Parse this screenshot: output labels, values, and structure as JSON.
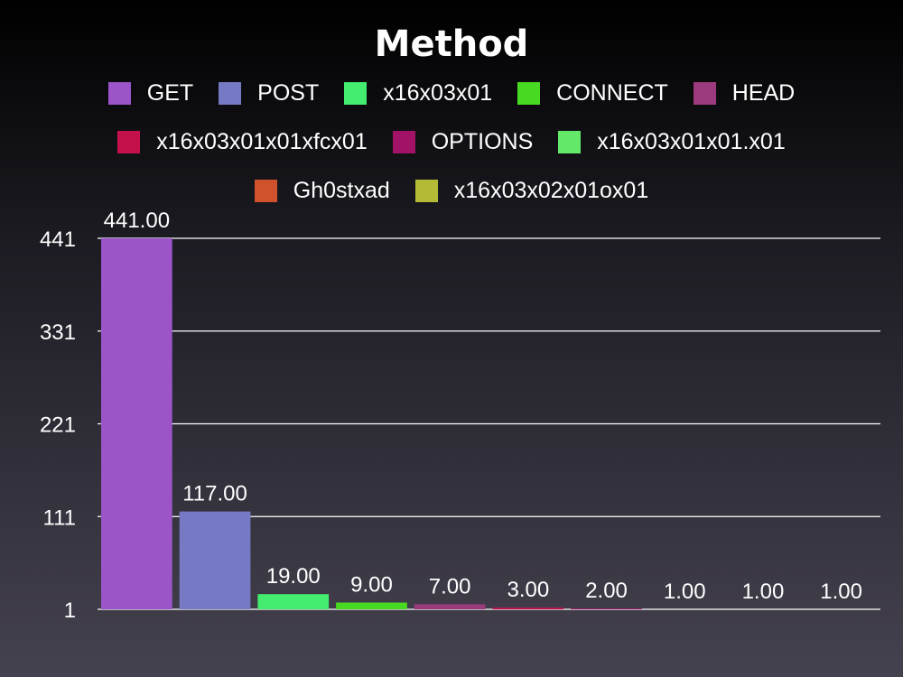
{
  "chart_data": {
    "type": "bar",
    "title": "Method",
    "categories": [
      "GET",
      "POST",
      "x16x03x01",
      "CONNECT",
      "HEAD",
      "x16x03x01x01xfcx01",
      "OPTIONS",
      "x16x03x01x01.x01",
      "Gh0stxad",
      "x16x03x02x01ox01"
    ],
    "values": [
      441,
      117,
      19,
      9,
      7,
      3,
      2,
      1,
      1,
      1
    ],
    "value_labels": [
      "441.00",
      "117.00",
      "19.00",
      "9.00",
      "7.00",
      "3.00",
      "2.00",
      "1.00",
      "1.00",
      "1.00"
    ],
    "colors": [
      "#9b55c9",
      "#7679c4",
      "#44ec6f",
      "#48d922",
      "#9b3a7c",
      "#c5114b",
      "#a21368",
      "#64e86a",
      "#d0522c",
      "#b5ba36"
    ],
    "yticks": [
      441,
      331,
      221,
      111,
      1
    ],
    "ylim": [
      1,
      441
    ],
    "legend_rows": [
      [
        0,
        1,
        2,
        3,
        4
      ],
      [
        5,
        6,
        7
      ],
      [
        8,
        9
      ]
    ],
    "legend_position": "top",
    "grid": true
  }
}
